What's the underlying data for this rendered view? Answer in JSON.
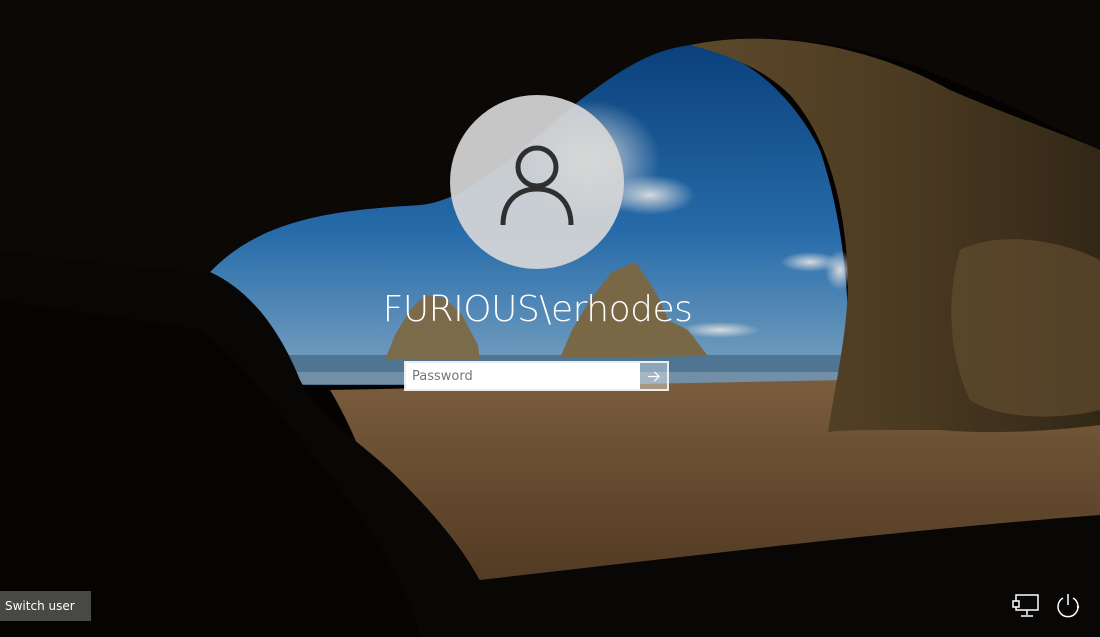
{
  "login": {
    "username": "FURIOUS\\erhodes",
    "password_placeholder": "Password"
  },
  "footer": {
    "switch_user_label": "Switch user"
  },
  "icons": {
    "avatar": "user-icon",
    "submit": "arrow-right-icon",
    "network": "network-icon",
    "power": "power-icon"
  },
  "colors": {
    "avatar_bg": "#d7d7d7",
    "text": "#ffffff",
    "switch_user_bg": "#5f5f5f"
  }
}
